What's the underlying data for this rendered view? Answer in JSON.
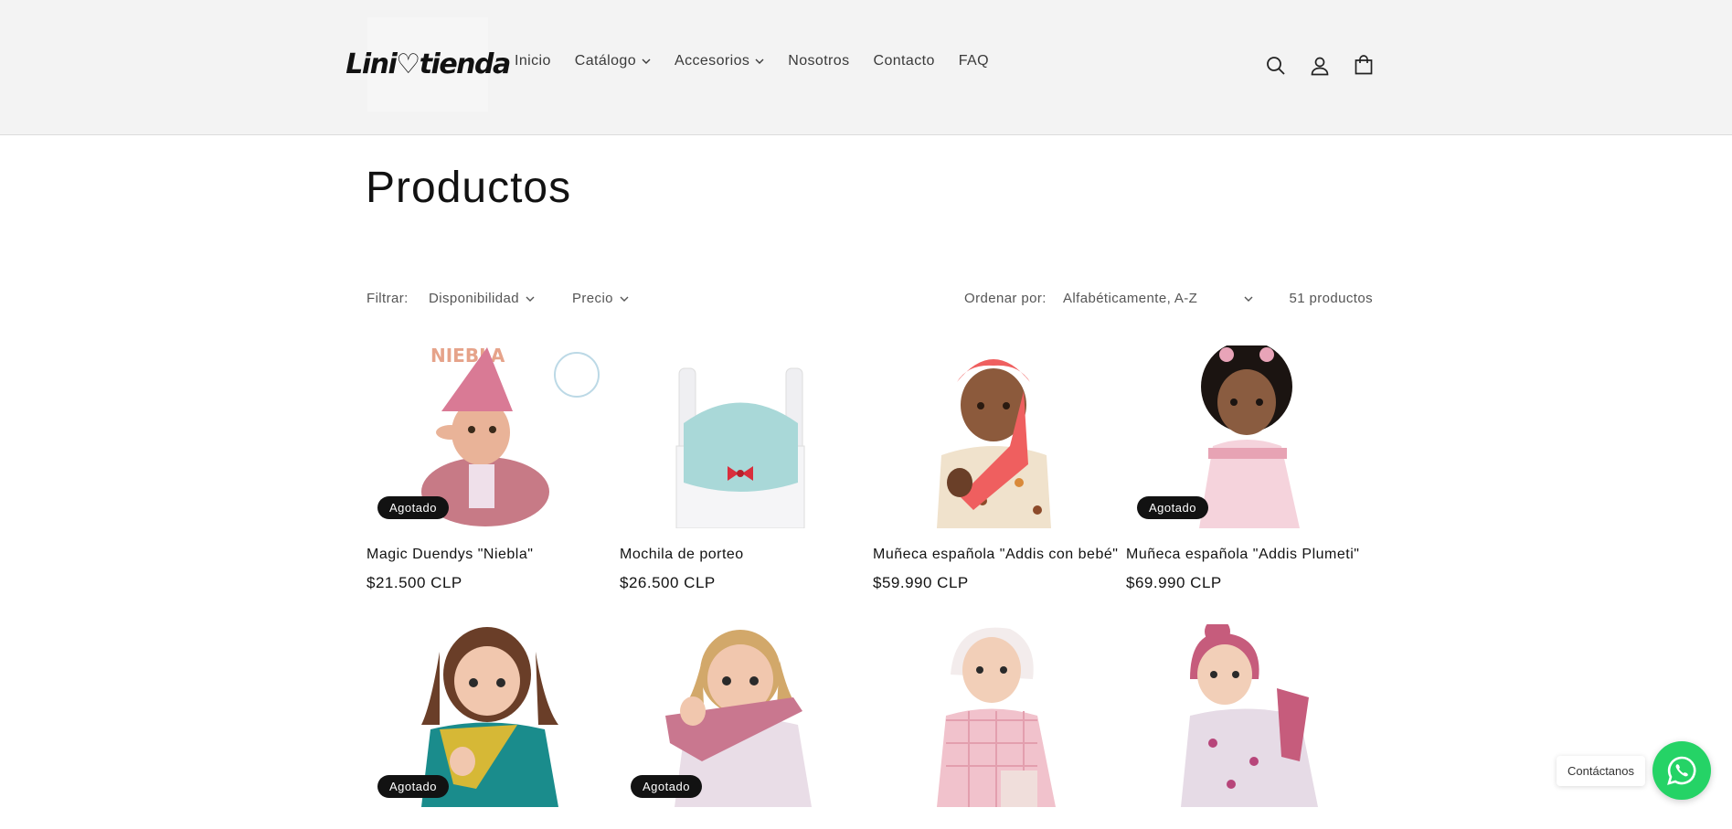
{
  "header": {
    "logo_text": "Lini♡tienda",
    "nav": [
      {
        "label": "Inicio",
        "has_dropdown": false
      },
      {
        "label": "Catálogo",
        "has_dropdown": true
      },
      {
        "label": "Accesorios",
        "has_dropdown": true
      },
      {
        "label": "Nosotros",
        "has_dropdown": false
      },
      {
        "label": "Contacto",
        "has_dropdown": false
      },
      {
        "label": "FAQ",
        "has_dropdown": false
      }
    ],
    "icons": [
      "search-icon",
      "account-icon",
      "cart-icon"
    ]
  },
  "page": {
    "title": "Productos"
  },
  "filters": {
    "label": "Filtrar:",
    "facets": [
      "Disponibilidad",
      "Precio"
    ],
    "sort_label": "Ordenar por:",
    "sort_value": "Alfabéticamente, A-Z",
    "count": "51 productos"
  },
  "products": [
    {
      "title": "Magic Duendys \"Niebla\"",
      "price": "$21.500 CLP",
      "badge": "Agotado"
    },
    {
      "title": "Mochila de porteo",
      "price": "$26.500 CLP",
      "badge": ""
    },
    {
      "title": "Muñeca española \"Addis con bebé\"",
      "price": "$59.990 CLP",
      "badge": ""
    },
    {
      "title": "Muñeca española \"Addis Plumeti\"",
      "price": "$69.990 CLP",
      "badge": "Agotado"
    },
    {
      "badge": "Agotado"
    },
    {
      "badge": "Agotado"
    },
    {
      "badge": ""
    },
    {
      "badge": ""
    }
  ],
  "whatsapp": {
    "label": "Contáctanos",
    "color": "#25d366"
  },
  "colors": {
    "header_bg": "#f3f3f3",
    "badge_bg": "#121212",
    "text": "#121212"
  }
}
